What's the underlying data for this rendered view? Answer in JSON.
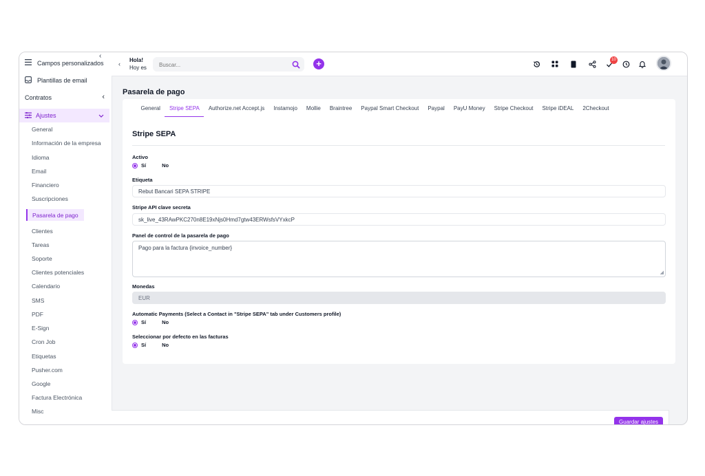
{
  "sidebar": {
    "top_items": [
      "Campos personalizados",
      "Plantillas de email"
    ],
    "contratos": "Contratos",
    "ajustes": "Ajustes",
    "items": [
      "General",
      "Información de la empresa",
      "Idioma",
      "Email",
      "Financiero",
      "Suscripciones",
      "Pasarela de pago",
      "Clientes",
      "Tareas",
      "Soporte",
      "Clientes potenciales",
      "Calendario",
      "SMS",
      "PDF",
      "E-Sign",
      "Cron Job",
      "Etiquetas",
      "Pusher.com",
      "Google",
      "Factura Electrónica",
      "Misc"
    ],
    "active_item": "Pasarela de pago"
  },
  "topbar": {
    "greeting": "Hola!",
    "greeting_sub": "Hoy es",
    "search_placeholder": "Buscar...",
    "notification_count": "10"
  },
  "page": {
    "title": "Pasarela de pago",
    "tabs": [
      "General",
      "Stripe SEPA",
      "Authorize.net Accept.js",
      "Instamojo",
      "Mollie",
      "Braintree",
      "Paypal Smart Checkout",
      "Paypal",
      "PayU Money",
      "Stripe Checkout",
      "Stripe iDEAL",
      "2Checkout"
    ],
    "active_tab": "Stripe SEPA",
    "section_title": "Stripe SEPA"
  },
  "form": {
    "activo_label": "Activo",
    "etiqueta_label": "Etiqueta",
    "etiqueta_value": "Rebut Bancari SEPA STRIPE",
    "api_key_label": "Stripe API clave secreta",
    "api_key_value": "sk_live_43RAwPKC270n8E19xNjs0Hmd7gtw43ERWsfsVYxkcP",
    "panel_label": "Panel de control de la pasarela de pago",
    "panel_value": "Pago para la factura {invoice_number}",
    "monedas_label": "Monedas",
    "monedas_value": "EUR",
    "auto_payments_label": "Automatic Payments (Select a Contact in \"Stripe SEPA\" tab under Customers profile)",
    "default_label": "Seleccionar por defecto en las facturas",
    "yes": "Sí",
    "no": "No"
  },
  "footer": {
    "save_label": "Guardar ajustes"
  },
  "colors": {
    "accent": "#9333ea",
    "accent_light": "#f3e8ff",
    "badge": "#ef4444"
  }
}
